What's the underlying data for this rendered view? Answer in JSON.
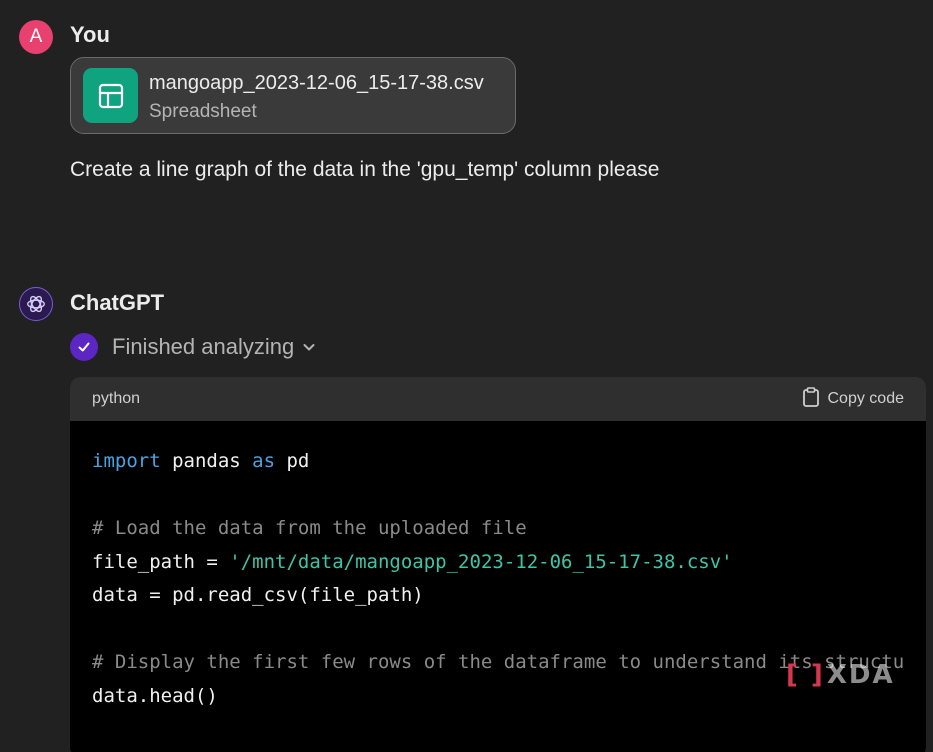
{
  "user": {
    "avatar_letter": "A",
    "name": "You",
    "attachment": {
      "file_name": "mangoapp_2023-12-06_15-17-38.csv",
      "file_type": "Spreadsheet",
      "icon": "spreadsheet-icon"
    },
    "message": "Create a line graph of the data in the 'gpu_temp' column please"
  },
  "assistant": {
    "name": "ChatGPT",
    "icon": "openai-logo-icon",
    "status": "Finished analyzing",
    "code_block": {
      "language": "python",
      "copy_label": "Copy code",
      "lines": [
        {
          "parts": [
            {
              "t": "import",
              "c": "kw"
            },
            {
              "t": " pandas ",
              "c": ""
            },
            {
              "t": "as",
              "c": "kw"
            },
            {
              "t": " pd",
              "c": ""
            }
          ]
        },
        {
          "parts": []
        },
        {
          "parts": [
            {
              "t": "# Load the data from the uploaded file",
              "c": "cmt"
            }
          ]
        },
        {
          "parts": [
            {
              "t": "file_path = ",
              "c": ""
            },
            {
              "t": "'/mnt/data/mangoapp_2023-12-06_15-17-38.csv'",
              "c": "str"
            }
          ]
        },
        {
          "parts": [
            {
              "t": "data = pd.read_csv(file_path)",
              "c": ""
            }
          ]
        },
        {
          "parts": []
        },
        {
          "parts": [
            {
              "t": "# Display the first few rows of the dataframe to understand its structu",
              "c": "cmt"
            }
          ]
        },
        {
          "parts": [
            {
              "t": "data.head()",
              "c": ""
            }
          ]
        }
      ]
    }
  },
  "watermark": {
    "text": "XDA"
  },
  "colors": {
    "background": "#212121",
    "avatar_you": "#e8416f",
    "spreadsheet_green": "#10a37f",
    "check_purple": "#5b26c4",
    "keyword_blue": "#4aa3e0",
    "string_teal": "#40c4a6",
    "comment_gray": "#8a8a8a"
  }
}
